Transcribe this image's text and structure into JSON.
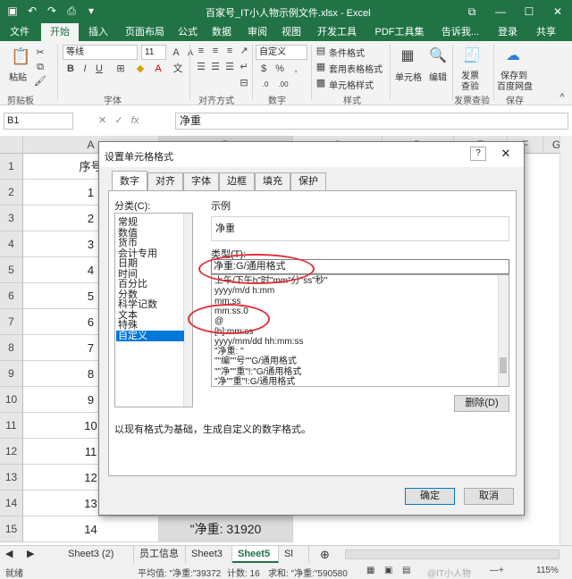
{
  "window": {
    "title": "百家号_IT小人物示例文件.xlsx - Excel",
    "controls": [
      "restore-icon",
      "minimize-icon",
      "maximize-icon",
      "close-icon"
    ]
  },
  "ribbon_tabs": [
    "文件",
    "开始",
    "插入",
    "页面布局",
    "公式",
    "数据",
    "审阅",
    "视图",
    "开发工具",
    "PDF工具集",
    "告诉我...",
    "登录",
    "共享"
  ],
  "ribbon": {
    "clipboard": {
      "paste": "粘贴",
      "label": "剪贴板"
    },
    "font": {
      "name": "等线",
      "size": "11",
      "label": "字体"
    },
    "alignment": {
      "label": "对齐方式"
    },
    "number": {
      "format": "自定义",
      "label": "数字"
    },
    "styles": {
      "conditional": "条件格式",
      "table": "套用表格格式",
      "cell": "单元格样式",
      "label": "样式"
    },
    "cells": {
      "button": "单元格"
    },
    "editing": {
      "button": "编辑"
    },
    "invoice": {
      "button1": "发票",
      "button2": "查验",
      "label": "发票查验"
    },
    "save": {
      "button1": "保存到",
      "button2": "百度网盘",
      "label": "保存"
    }
  },
  "formula_bar": {
    "cell_ref": "B1",
    "formula": "净重"
  },
  "grid": {
    "columns": [
      "A",
      "B",
      "C",
      "D",
      "E",
      "F",
      "G"
    ],
    "rows": [
      "1",
      "2",
      "3",
      "4",
      "5",
      "6",
      "7",
      "8",
      "9",
      "10",
      "11",
      "12",
      "13",
      "14",
      "15"
    ],
    "colA": [
      "序号",
      "1",
      "2",
      "3",
      "4",
      "5",
      "6",
      "7",
      "8",
      "9",
      "10",
      "11",
      "12",
      "13",
      "14"
    ],
    "b15": "\"净重: 31920"
  },
  "sheet_tabs": [
    "Sheet3 (2)",
    "员工信息",
    "Sheet3",
    "Sheet5",
    "Sl"
  ],
  "active_sheet": "Sheet5",
  "status": {
    "ready": "就绪",
    "average": "平均值: \"净重:\"39372",
    "count": "计数: 16",
    "sum": "求和: \"净重:\"590580",
    "zoom": "115%",
    "watermark": "@IT小人物"
  },
  "dialog": {
    "title": "设置单元格格式",
    "tabs": [
      "数字",
      "对齐",
      "字体",
      "边框",
      "填充",
      "保护"
    ],
    "active_tab": "数字",
    "category_label": "分类(C):",
    "categories": [
      "常规",
      "数值",
      "货币",
      "会计专用",
      "日期",
      "时间",
      "百分比",
      "分数",
      "科学记数",
      "文本",
      "特殊",
      "自定义"
    ],
    "selected_category": "自定义",
    "sample_label": "示例",
    "sample_value": "净重",
    "type_label": "类型(T):",
    "type_value": "净重:G/通用格式",
    "formats": [
      "上午/下午h\"时\"mm\"分\"ss\"秒\"",
      "yyyy/m/d h:mm",
      "mm:ss",
      "mm:ss.0",
      "@",
      "[h]:mm:ss",
      "yyyy/mm/dd hh:mm:ss",
      "\"净重: \"",
      "\"\"编\"\"号\"\"G/通用格式",
      "\"\"净\"\"重\"!:\"G/通用格式",
      "\"净\"\"重\"!:G/通用格式"
    ],
    "delete_button": "删除(D)",
    "description": "以现有格式为基础，生成自定义的数字格式。",
    "ok_button": "确定",
    "cancel_button": "取消",
    "annotation_color": "#e0303a"
  }
}
